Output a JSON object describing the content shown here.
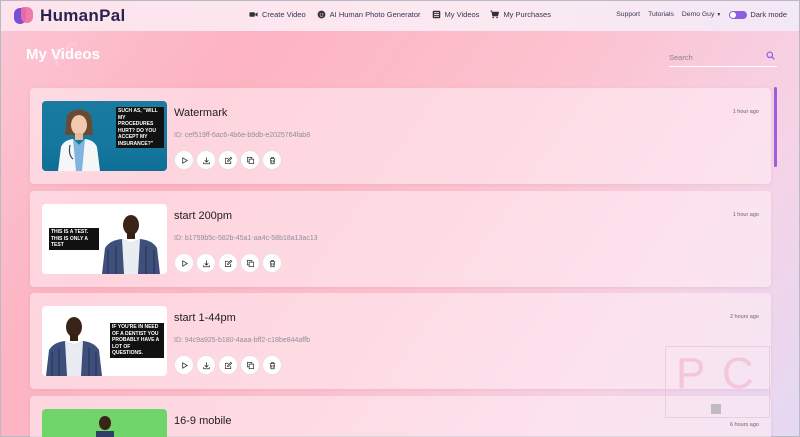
{
  "brand": {
    "name": "HumanPal"
  },
  "nav": {
    "items": [
      {
        "label": "Create Video",
        "icon": "video-camera-icon"
      },
      {
        "label": "AI Human Photo Generator",
        "icon": "face-icon"
      },
      {
        "label": "My Videos",
        "icon": "video-list-icon"
      },
      {
        "label": "My Purchases",
        "icon": "cart-icon"
      }
    ],
    "support": "Support",
    "tutorials": "Tutorials",
    "user": "Demo Guy",
    "dark_mode": "Dark mode"
  },
  "page": {
    "title": "My Videos",
    "search_placeholder": "Search"
  },
  "videos": [
    {
      "title": "Watermark",
      "id": "ID: cef519ff-6ac6-4b6e-b9db-e2025764fab8",
      "time": "1 hour ago",
      "caption": "SUCH AS, \"WILL MY PROCEDURES HURT? DO YOU ACCEPT MY INSURANCE?\""
    },
    {
      "title": "start 200pm",
      "id": "ID: b1759b5c-582b-45a1-aa4c-58b18a13ac13",
      "time": "1 hour ago",
      "caption": "THIS IS A TEST. THIS IS ONLY A TEST"
    },
    {
      "title": "start 1-44pm",
      "id": "ID: 94c9a925-b180-4aaa-bff2-c18be844affb",
      "time": "2 hours ago",
      "caption": "IF YOU'RE IN NEED OF A DENTIST YOU PROBABLY HAVE A LOT OF QUESTIONS."
    },
    {
      "title": "16-9 mobile",
      "id": "",
      "time": "6 hours ago",
      "caption": ""
    }
  ],
  "colors": {
    "accent": "#8b5fe0",
    "brand_pink": "#ec6fa3"
  }
}
